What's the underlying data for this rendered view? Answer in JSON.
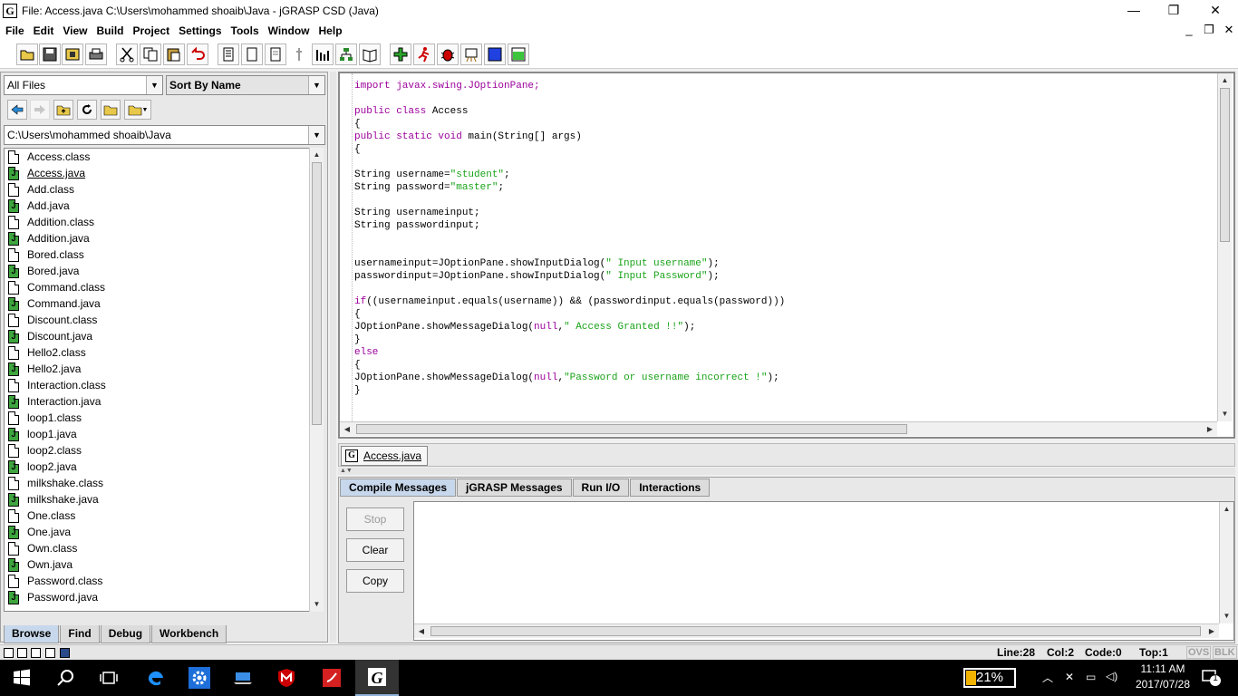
{
  "window": {
    "title": "File: Access.java  C:\\Users\\mohammed shoaib\\Java - jGRASP CSD (Java)",
    "app_icon": "G",
    "minimize": "—",
    "restore": "❐",
    "close": "✕"
  },
  "menu": [
    "File",
    "Edit",
    "View",
    "Build",
    "Project",
    "Settings",
    "Tools",
    "Window",
    "Help"
  ],
  "mdi_controls": [
    "_",
    "❐",
    "✕"
  ],
  "browse": {
    "filter": "All Files",
    "sort": "Sort By Name",
    "path": "C:\\Users\\mohammed shoaib\\Java",
    "files": [
      {
        "name": "Access.class",
        "type": "class"
      },
      {
        "name": "Access.java",
        "type": "java",
        "active": true
      },
      {
        "name": "Add.class",
        "type": "class"
      },
      {
        "name": "Add.java",
        "type": "java"
      },
      {
        "name": "Addition.class",
        "type": "class"
      },
      {
        "name": "Addition.java",
        "type": "java"
      },
      {
        "name": "Bored.class",
        "type": "class"
      },
      {
        "name": "Bored.java",
        "type": "java"
      },
      {
        "name": "Command.class",
        "type": "class"
      },
      {
        "name": "Command.java",
        "type": "java"
      },
      {
        "name": "Discount.class",
        "type": "class"
      },
      {
        "name": "Discount.java",
        "type": "java"
      },
      {
        "name": "Hello2.class",
        "type": "class"
      },
      {
        "name": "Hello2.java",
        "type": "java"
      },
      {
        "name": "Interaction.class",
        "type": "class"
      },
      {
        "name": "Interaction.java",
        "type": "java"
      },
      {
        "name": "loop1.class",
        "type": "class"
      },
      {
        "name": "loop1.java",
        "type": "java"
      },
      {
        "name": "loop2.class",
        "type": "class"
      },
      {
        "name": "loop2.java",
        "type": "java"
      },
      {
        "name": "milkshake.class",
        "type": "class"
      },
      {
        "name": "milkshake.java",
        "type": "java"
      },
      {
        "name": "One.class",
        "type": "class"
      },
      {
        "name": "One.java",
        "type": "java"
      },
      {
        "name": "Own.class",
        "type": "class"
      },
      {
        "name": "Own.java",
        "type": "java"
      },
      {
        "name": "Password.class",
        "type": "class"
      },
      {
        "name": "Password.java",
        "type": "java"
      }
    ],
    "tabs": [
      "Browse",
      "Find",
      "Debug",
      "Workbench"
    ]
  },
  "editor": {
    "tab_label": "Access.java",
    "code_lines": [
      [
        {
          "t": "import javax.swing.JOptionPane;",
          "c": "kw"
        }
      ],
      [],
      [
        {
          "t": "public class ",
          "c": "kw"
        },
        {
          "t": "Access",
          "c": ""
        }
      ],
      [
        {
          "t": "{",
          "c": ""
        }
      ],
      [
        {
          "t": "public static void ",
          "c": "kw"
        },
        {
          "t": "main(String[] args)",
          "c": ""
        }
      ],
      [
        {
          "t": "{",
          "c": ""
        }
      ],
      [],
      [
        {
          "t": "String username=",
          "c": ""
        },
        {
          "t": "\"student\"",
          "c": "st"
        },
        {
          "t": ";",
          "c": ""
        }
      ],
      [
        {
          "t": "String password=",
          "c": ""
        },
        {
          "t": "\"master\"",
          "c": "st"
        },
        {
          "t": ";",
          "c": ""
        }
      ],
      [],
      [
        {
          "t": "String usernameinput;",
          "c": ""
        }
      ],
      [
        {
          "t": "String passwordinput;",
          "c": ""
        }
      ],
      [],
      [],
      [
        {
          "t": "usernameinput=JOptionPane.showInputDialog(",
          "c": ""
        },
        {
          "t": "\" Input username\"",
          "c": "st"
        },
        {
          "t": ");",
          "c": ""
        }
      ],
      [
        {
          "t": "passwordinput=JOptionPane.showInputDialog(",
          "c": ""
        },
        {
          "t": "\" Input Password\"",
          "c": "st"
        },
        {
          "t": ");",
          "c": ""
        }
      ],
      [],
      [
        {
          "t": "if",
          "c": "kw"
        },
        {
          "t": "((usernameinput.equals(username)) && (passwordinput.equals(password)))",
          "c": ""
        }
      ],
      [
        {
          "t": "{",
          "c": ""
        }
      ],
      [
        {
          "t": "JOptionPane.showMessageDialog(",
          "c": ""
        },
        {
          "t": "null",
          "c": "kw"
        },
        {
          "t": ",",
          "c": ""
        },
        {
          "t": "\" Access Granted !!\"",
          "c": "st"
        },
        {
          "t": ");",
          "c": ""
        }
      ],
      [
        {
          "t": "}",
          "c": ""
        }
      ],
      [
        {
          "t": "else",
          "c": "kw"
        }
      ],
      [
        {
          "t": "{",
          "c": ""
        }
      ],
      [
        {
          "t": "JOptionPane.showMessageDialog(",
          "c": ""
        },
        {
          "t": "null",
          "c": "kw"
        },
        {
          "t": ",",
          "c": ""
        },
        {
          "t": "\"Password or username incorrect !\"",
          "c": "st"
        },
        {
          "t": ");",
          "c": ""
        }
      ],
      [
        {
          "t": "}",
          "c": ""
        }
      ]
    ]
  },
  "messages": {
    "tabs": [
      "Compile Messages",
      "jGRASP Messages",
      "Run I/O",
      "Interactions"
    ],
    "buttons": {
      "stop": "Stop",
      "clear": "Clear",
      "copy": "Copy"
    }
  },
  "status": {
    "line": "Line:28",
    "col": "Col:2",
    "code": "Code:0",
    "top": "Top:1",
    "ovs": "OVS",
    "blk": "BLK"
  },
  "taskbar": {
    "battery_pct": "21%",
    "battery_level": 0.21,
    "time": "11:11 AM",
    "date": "2017/07/28",
    "notification_count": "1"
  },
  "colors": {
    "keyword": "#9b009b",
    "string": "#19a319",
    "java_file_icon": "#3fa53f",
    "active_tab": "#c8d8ec"
  }
}
